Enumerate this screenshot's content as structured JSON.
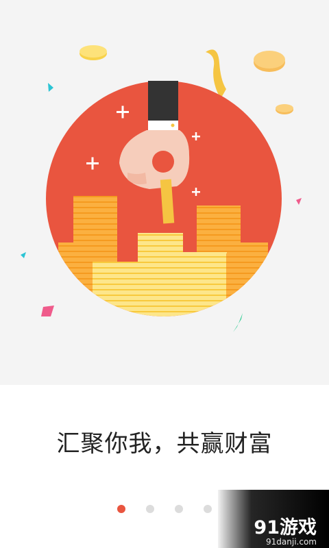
{
  "onboarding": {
    "slogan": "汇聚你我，共赢财富",
    "pager": {
      "total": 4,
      "active_index": 0
    }
  },
  "watermark": {
    "logo": "91游戏",
    "site": "91danji.com"
  },
  "colors": {
    "background": "#f4f4f4",
    "circle": "#e9553f",
    "coin_gold": "#fcd34d",
    "coin_orange": "#f9a825",
    "dot_active": "#e9553f",
    "dot_inactive": "#dcdcdc"
  }
}
